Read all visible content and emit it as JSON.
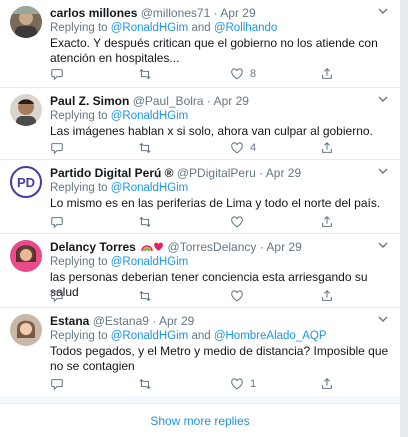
{
  "tweets": [
    {
      "name": "carlos millones",
      "handle": "@millones71",
      "time": "Apr 29",
      "replying_prefix": "Replying to ",
      "replying_to": [
        "@RonaldHGim",
        "@Rollhando"
      ],
      "text": "Exacto. Y después critican que el gobierno no los atiende con atención en hospitales...",
      "replies": "",
      "retweets": "",
      "likes": "8"
    },
    {
      "name": "Paul Z. Simon",
      "handle": "@Paul_Bolra",
      "time": "Apr 29",
      "replying_prefix": "Replying to ",
      "replying_to": [
        "@RonaldHGim"
      ],
      "text": "Las imágenes hablan x si solo,  ahora van culpar al gobierno.",
      "replies": "",
      "retweets": "",
      "likes": "4"
    },
    {
      "name": "Partido Digital Perú ®",
      "handle": "@PDigitalPeru",
      "time": "Apr 29",
      "replying_prefix": "Replying to ",
      "replying_to": [
        "@RonaldHGim"
      ],
      "text": "Lo mismo es en las periferias de Lima y todo el norte del país.",
      "replies": "",
      "retweets": "",
      "likes": "",
      "avatar_text": "PD"
    },
    {
      "name": "Delancy Torres",
      "handle": "@TorresDelancy",
      "time": "Apr 29",
      "replying_prefix": "Replying to ",
      "replying_to": [
        "@RonaldHGim"
      ],
      "text": "las personas deberian tener conciencia esta arriesgando su salud",
      "replies": "",
      "retweets": "",
      "likes": ""
    },
    {
      "name": "Estana",
      "handle": "@Estana9",
      "time": "Apr 29",
      "replying_prefix": "Replying to ",
      "replying_to": [
        "@RonaldHGim",
        "@HombreAlado_AQP"
      ],
      "text": "Todos pegados, y el Metro y medio de distancia? Imposible que no se contagien",
      "replies": "",
      "retweets": "",
      "likes": "1"
    }
  ],
  "show_more": "Show more replies",
  "separator": " · ",
  "and_word": " and ",
  "colors": {
    "accent": "#1b95e0",
    "muted": "#657786",
    "text": "#14171a"
  },
  "icons": [
    "reply-icon",
    "retweet-icon",
    "like-icon",
    "share-icon",
    "caret-down-icon"
  ]
}
